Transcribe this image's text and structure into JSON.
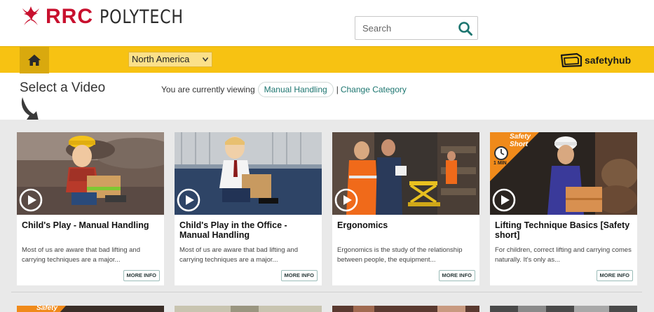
{
  "header": {
    "brand_primary": "RRC",
    "brand_secondary": "POLYTECH",
    "search_placeholder": "Search"
  },
  "navbar": {
    "region_selected": "North America",
    "safetyhub_label": "safetyhub"
  },
  "select": {
    "title": "Select a Video",
    "viewing_prefix": "You are currently viewing",
    "category": "Manual Handling",
    "separator": "|",
    "change_link": "Change Category"
  },
  "videos": [
    {
      "title": "Child's Play - Manual Handling",
      "description": "Most of us are aware that bad lifting and carrying techniques are a major...",
      "more_label": "MORE INFO"
    },
    {
      "title": "Child's Play in the Office - Manual Handling",
      "description": "Most of us are aware that bad lifting and carrying techniques are a major...",
      "more_label": "MORE INFO"
    },
    {
      "title": "Ergonomics",
      "description": "Ergonomics is the study of the relationship between people, the equipment...",
      "more_label": "MORE INFO"
    },
    {
      "title": "Lifting Technique Basics [Safety short]",
      "description": "For children, correct lifting and carrying comes naturally. It's only as...",
      "more_label": "MORE INFO",
      "badge_line1": "Safety",
      "badge_line2": "Short",
      "badge_duration": "1 MIN"
    }
  ],
  "next_row": {
    "badge_line1": "Safety"
  },
  "colors": {
    "brand_red": "#c8102e",
    "nav_yellow": "#f7c212",
    "link_teal": "#1d7670",
    "gallery_gray": "#e9e9e9"
  },
  "icons": {
    "logo": "rrc-star-icon",
    "search": "search-icon",
    "home": "home-icon",
    "safetyhub": "safetyhub-icon",
    "play": "play-icon",
    "arrow": "curved-arrow-icon"
  }
}
